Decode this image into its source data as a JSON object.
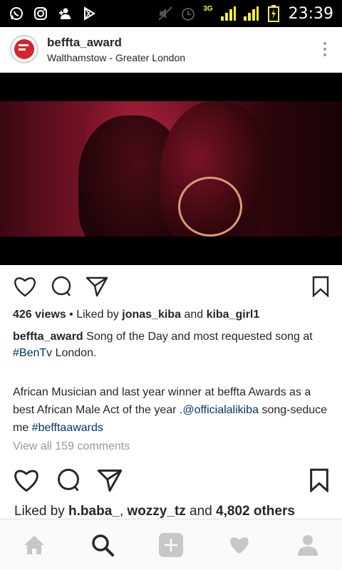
{
  "status_bar": {
    "network": "3G",
    "time": "23:39",
    "left_icons": [
      "whatsapp-icon",
      "instagram-icon",
      "add-user-icon",
      "play-store-icon"
    ],
    "right_icons": [
      "mute-icon",
      "alarm-icon",
      "signal-icon",
      "signal-icon",
      "battery-charging-icon"
    ]
  },
  "post": {
    "username": "beffta_award",
    "location": "Walthamstow - Greater London",
    "views": "426 views",
    "liked_by_prefix": " • Liked by ",
    "liker1": "jonas_kiba",
    "and": " and ",
    "liker2": "kiba_girl1",
    "caption_user": "beffta_award",
    "caption_text1": " Song of the Day and most requested song at ",
    "caption_tag1": "#BenTv",
    "caption_text2": " London.",
    "caption2_text1": "African Musician and last year winner at beffta Awards as a best African Male Act of the year .",
    "caption2_mention": "@officialalikiba",
    "caption2_text2": " song-seduce me ",
    "caption2_tag": "#befftaawards",
    "view_all": "View all 159 comments"
  },
  "next_post": {
    "liked_by": "Liked by ",
    "liker1": "h.baba_",
    "sep": ", ",
    "liker2": "wozzy_tz",
    "and": " and ",
    "others": "4,802 others"
  },
  "tabbar": {
    "tabs": [
      "home-icon",
      "search-icon",
      "add-post-icon",
      "activity-heart-icon",
      "profile-icon"
    ],
    "active": "search-icon"
  },
  "colors": {
    "link": "#003569",
    "muted": "#999999",
    "text": "#262626",
    "status_bar": "#000000",
    "battery": "#f5ef3a"
  }
}
